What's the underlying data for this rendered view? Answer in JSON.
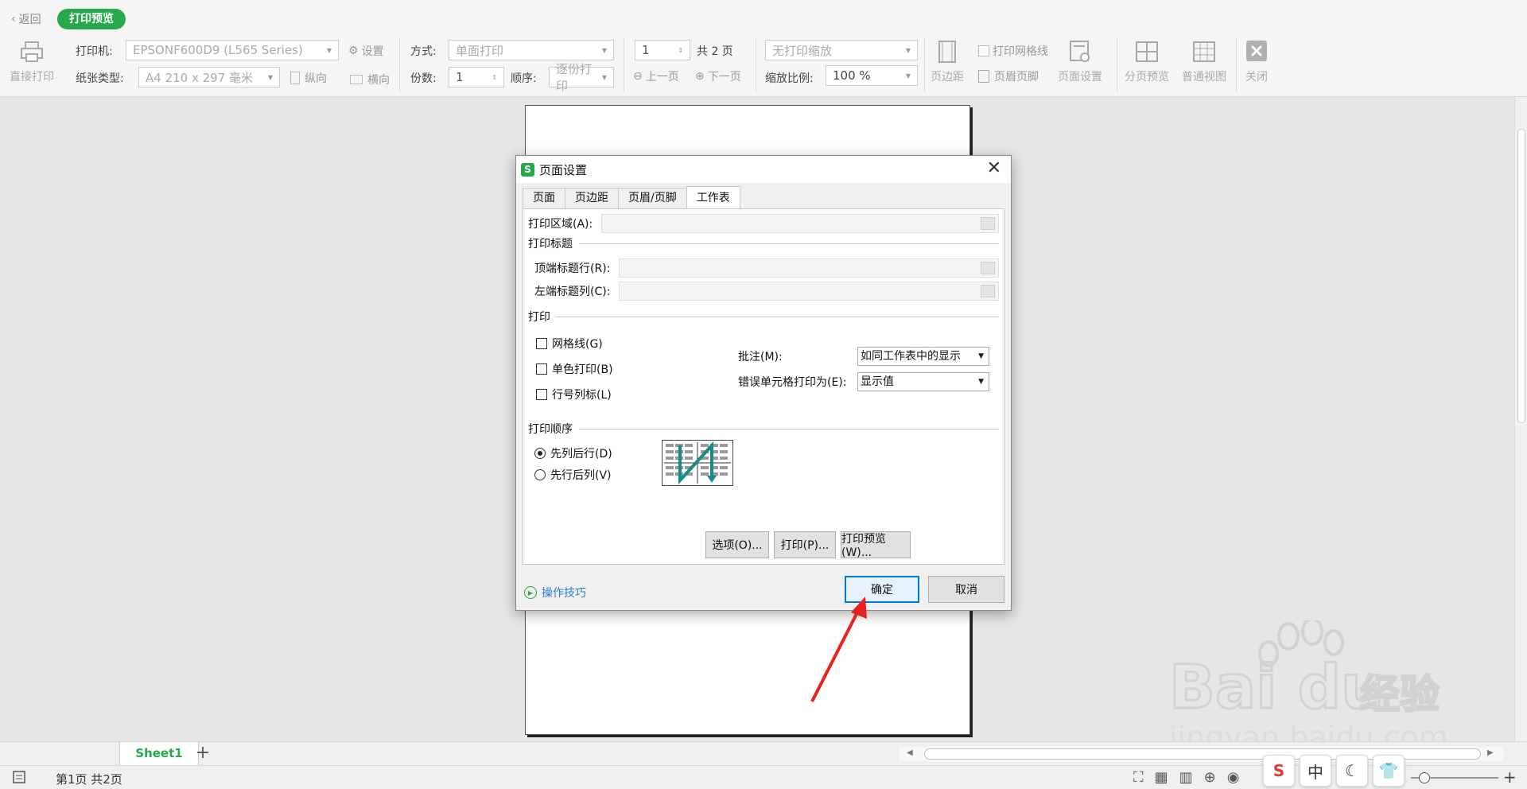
{
  "toolbar": {
    "back": "返回",
    "preview": "打印预览",
    "direct_print": "直接打印",
    "printer_label": "打印机:",
    "printer_value": "EPSONF600D9 (L565 Series)",
    "settings": "设置",
    "paper_label": "纸张类型:",
    "paper_value": "A4 210 x 297 毫米",
    "portrait": "纵向",
    "landscape": "横向",
    "mode_label": "方式:",
    "mode_value": "单面打印",
    "copies_label": "份数:",
    "copies_value": "1",
    "order_label": "顺序:",
    "order_value": "逐份打印",
    "page_value": "1",
    "total_pages": "共 2 页",
    "prev_page": "上一页",
    "next_page": "下一页",
    "scaling_value": "无打印缩放",
    "zoom_label": "缩放比例:",
    "zoom_value": "100 %",
    "margins": "页边距",
    "print_gridlines": "打印网格线",
    "header_footer": "页眉页脚",
    "page_setup": "页面设置",
    "page_break": "分页预览",
    "normal_view": "普通视图",
    "close": "关闭"
  },
  "dialog": {
    "title": "页面设置",
    "logo": "S",
    "tabs": [
      "页面",
      "页边距",
      "页眉/页脚",
      "工作表"
    ],
    "active_tab": "工作表",
    "print_area": "打印区域(A):",
    "print_titles": "打印标题",
    "top_rows": "顶端标题行(R):",
    "left_cols": "左端标题列(C):",
    "print_group": "打印",
    "gridlines": "网格线(G)",
    "mono": "单色打印(B)",
    "row_col_headers": "行号列标(L)",
    "comments_label": "批注(M):",
    "comments_value": "如同工作表中的显示",
    "errors_label": "错误单元格打印为(E):",
    "errors_value": "显示值",
    "order_group": "打印顺序",
    "down_then_over": "先列后行(D)",
    "over_then_down": "先行后列(V)",
    "options_btn": "选项(O)...",
    "print_btn": "打印(P)...",
    "preview_btn": "打印预览(W)...",
    "tips": "操作技巧",
    "ok": "确定",
    "cancel": "取消"
  },
  "sheets": {
    "tab": "Sheet1",
    "add": "+"
  },
  "status": {
    "page_info": "第1页 共2页"
  },
  "ime": {
    "s": "S",
    "zh": "中",
    "moon": "☾",
    "shirt": "👕"
  },
  "watermark": {
    "brand": "Bai du",
    "suffix": "经验",
    "url": "jingyan.baidu.com"
  },
  "colors": {
    "accent": "#27a84a",
    "primary_border": "#0078d7",
    "arrow": "#e82020"
  }
}
